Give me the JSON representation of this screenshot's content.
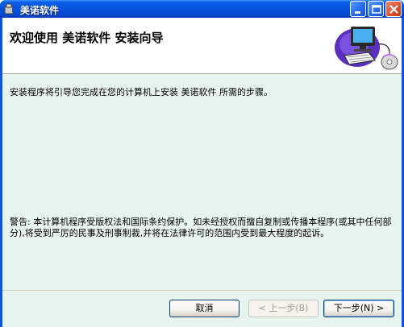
{
  "window": {
    "title": "美诺软件"
  },
  "banner": {
    "title": "欢迎使用 美诺软件 安装向导"
  },
  "body": {
    "intro": "安装程序将引导您完成在您的计算机上安装 美诺软件 所需的步骤。",
    "warning": "警告: 本计算机程序受版权法和国际条约保护。如未经授权而擅自复制或传播本程序(或其中任何部分),将受到严厉的民事及刑事制裁,并将在法律许可的范围内受到最大程度的起诉。"
  },
  "buttons": {
    "cancel": "取消",
    "back": "< 上一步(B)",
    "next": "下一步(N) >"
  },
  "colors": {
    "titlebar": "#0553dd",
    "client_bg": "#e8f4ef",
    "banner_bg": "#ffffff"
  }
}
